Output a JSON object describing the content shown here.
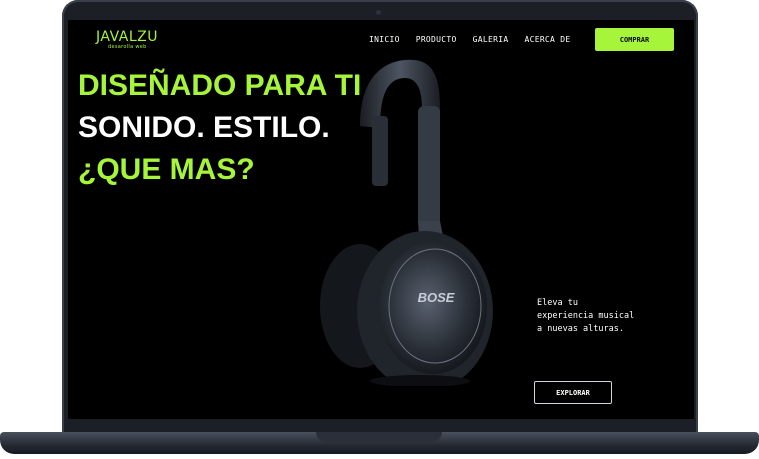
{
  "brand": {
    "name": "JAVALZU",
    "tagline": "desarolla web"
  },
  "nav": {
    "items": [
      "INICIO",
      "PRODUCTO",
      "GALERIA",
      "ACERCA DE"
    ]
  },
  "header": {
    "buy_label": "COMPRAR"
  },
  "hero": {
    "line1": "DISEÑADO PARA TI",
    "line2": "SONIDO. ESTILO.",
    "line3": "¿QUE MAS?",
    "description": "Eleva tu experiencia musical a nuevas alturas.",
    "cta_label": "EXPLORAR",
    "product_logo": "BOSE"
  },
  "colors": {
    "accent": "#a6f53b",
    "background": "#000000",
    "frame": "#1c1f26"
  }
}
